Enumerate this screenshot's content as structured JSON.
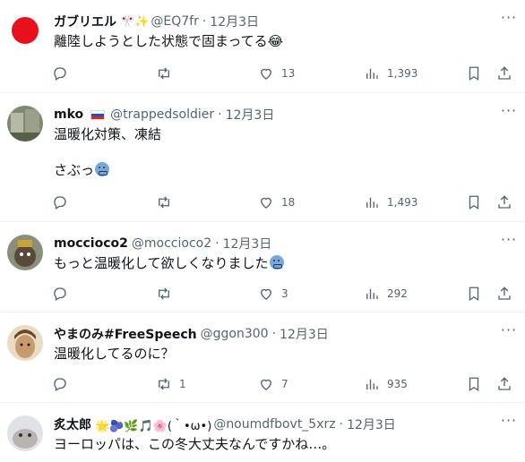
{
  "tweets": [
    {
      "name": "ガブリエル",
      "name_emoji": "🎌✨",
      "handle": "@EQ7fr",
      "date": "12月3日",
      "text": "離陸しようとした状態で固まってる😂",
      "replies": "",
      "retweets": "",
      "likes": "13",
      "views": "1,393"
    },
    {
      "name": "mko",
      "name_emoji": "",
      "handle": "@trappedsoldier",
      "date": "12月3日",
      "text": "温暖化対策、凍結\n\nさぶっ",
      "replies": "",
      "retweets": "",
      "likes": "18",
      "views": "1,493"
    },
    {
      "name": "moccioco2",
      "name_emoji": "",
      "handle": "@moccioco2",
      "date": "12月3日",
      "text": "もっと温暖化して欲しくなりました",
      "replies": "",
      "retweets": "",
      "likes": "3",
      "views": "292"
    },
    {
      "name": "やまのみ#FreeSpeech",
      "name_emoji": "",
      "handle": "@ggon300",
      "date": "12月3日",
      "text": "温暖化してるのに？",
      "replies": "",
      "retweets": "1",
      "likes": "7",
      "views": "935"
    },
    {
      "name": "炙太郎",
      "name_emoji": "🌟🫐🌿🎵🌸(｀•ω•)",
      "handle": "@noumdfbovt_5xrz",
      "date": "12月3日",
      "text": "ヨーロッパは、この冬大丈夫なんですかね…。",
      "replies": "",
      "retweets": "",
      "likes": "",
      "views": ""
    }
  ],
  "more_label": "···",
  "separator": "·",
  "colors": {
    "text": "#0f1419",
    "secondary": "#536471",
    "border": "#eff3f4"
  }
}
